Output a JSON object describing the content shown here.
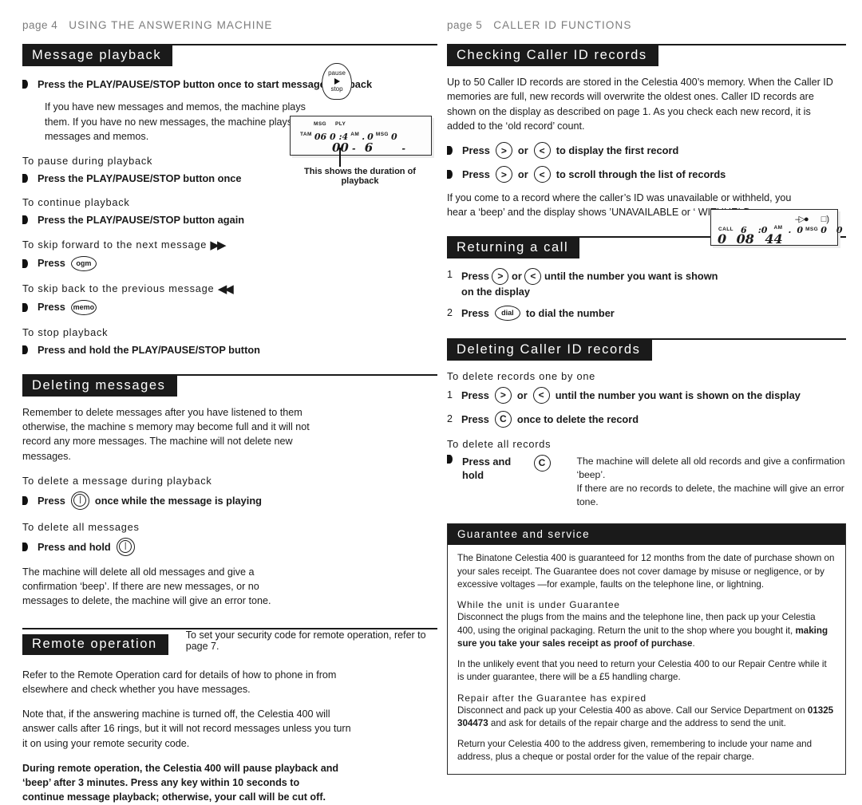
{
  "left": {
    "runhead": {
      "page": "page 4",
      "title": "USING THE ANSWERING MACHINE"
    },
    "s1": {
      "heading": "Message playback",
      "a1": "Press the PLAY/PAUSE/STOP button once to start message playback",
      "a1_note": "If you have new messages and memos, the machine plays them. If you have no new messages, the machine plays all messages and memos.",
      "sub1": "To pause during playback",
      "a2": "Press the PLAY/PAUSE/STOP button once",
      "sub2": "To continue playback",
      "a3": "Press the PLAY/PAUSE/STOP button again",
      "sub3": "To skip forward to the next message",
      "a4": "Press",
      "a4_key": "ogm",
      "sub4": "To skip back to the previous message",
      "a5": "Press",
      "a5_key": "memo",
      "sub5": "To stop playback",
      "a6": "Press and hold the PLAY/PAUSE/STOP button",
      "pause_key": {
        "top": "pause",
        "bottom": "stop"
      }
    },
    "lcd1": {
      "label_msg": "MSG",
      "label_ply": "PLY",
      "tam": "TAM",
      "row_a": "06 0 :4",
      "row_a_am": "AM",
      "row_a_dot": ".",
      "row_a_b": "0",
      "row_a_msg": "MSG",
      "row_a_c": "0",
      "row_b": "00",
      "row_b2": "6",
      "row_b_dash": "-",
      "row_b_dash2": "-",
      "caption": "This shows the duration of playback"
    },
    "s2": {
      "heading": "Deleting messages",
      "p1": "Remember to delete messages after you have listened to them   otherwise, the machine s memory may become full and it will not record any more messages. The machine will not delete new messages.",
      "sub1": "To delete a message during playback",
      "a1_pre": "Press",
      "a1_post": "once while the message is playing",
      "sub2": "To delete all messages",
      "a2_pre": "Press and hold",
      "note": "The machine will delete all old messages and give a confirmation ‘beep’. If there are new messages, or no messages to delete, the machine will give an error tone."
    },
    "s3": {
      "heading": "Remote operation",
      "note": "To set your security code for remote operation, refer to page 7.",
      "p1": "Refer to the Remote Operation card for details of how to phone in from elsewhere and check whether you have messages.",
      "p2": "Note that, if the answering machine is turned off, the Celestia 400 will answer calls after 16 rings, but it will not record messages unless you turn it on using your remote security code.",
      "p3": "During remote operation, the Celestia 400 will pause playback and ‘beep’ after 3 minutes. Press any key within 10 seconds to continue message playback; otherwise, your call will be cut off."
    }
  },
  "right": {
    "runhead": {
      "page": "page 5",
      "title": "CALLER ID FUNCTIONS"
    },
    "s1": {
      "heading": "Checking Caller ID records",
      "p1": "Up to 50 Caller ID records are stored in the Celestia 400’s memory.  When the Caller ID memories are full, new records will overwrite the oldest ones. Caller ID records are shown on the display as described on page 1. As you check each new record, it is added to the ‘old record’ count.",
      "a1_pre": "Press",
      "a1_or": "or",
      "a1_post": "to display the first record",
      "a2_pre": "Press",
      "a2_or": "or",
      "a2_post": "to scroll through the list of records",
      "p2": "If you come to a record where the caller’s ID was unavailable or withheld, you hear a ‘beep’ and the display shows ’UNAVAILABLE or ‘ WITHHELD"
    },
    "s2": {
      "heading": "Returning a call",
      "n1": "1",
      "n1_pre": "Press",
      "n1_or": "or",
      "n1_post": "until the number you want is shown",
      "n1_post2": "on the display",
      "n2": "2",
      "n2_pre": "Press",
      "n2_key": "dial",
      "n2_post": "to dial the number"
    },
    "lcd2": {
      "call": "CALL",
      "row_a1": "6",
      "row_a2": ":0",
      "row_a_am": "AM",
      "row_a_dot": ".",
      "row_a3": "0",
      "row_a_msg": "MSG",
      "row_a4": "0",
      "row_a5": "0",
      "row_b1": "0",
      "row_b2": "08",
      "row_b3": "44"
    },
    "s3": {
      "heading": "Deleting Caller ID records",
      "sub1": "To delete records one by one",
      "n1": "1",
      "n1_pre": "Press",
      "n1_or": "or",
      "n1_post": "until the number you want is shown on the display",
      "n2": "2",
      "n2_pre": "Press",
      "n2_key": "C",
      "n2_post": "once to delete the record",
      "sub2": "To delete all records",
      "a1_pre": "Press and hold",
      "a1_key": "C",
      "note1": "The machine will delete all old records and give a confirmation ‘beep’.",
      "note2": "If there are no records to delete, the machine will give an error tone."
    },
    "gbox": {
      "heading": "Guarantee and service",
      "p1": "The Binatone Celestia 400 is guaranteed for 12 months from the date of purchase shown on your sales receipt. The Guarantee does not cover damage by misuse or negligence, or by excessive voltages —for example, faults on the telephone line, or lightning.",
      "sub1": "While the unit is under Guarantee",
      "p2_a": "Disconnect the plugs from the mains and the telephone line, then pack up your Celestia 400, using the original packaging. Return the unit to the shop where you bought it, ",
      "p2_b": "making sure you take your sales receipt as proof of purchase",
      "p2_c": ".",
      "p3": "In the unlikely event that you need to return your Celestia 400 to our Repair Centre while it is under guarantee, there will be a £5 handling charge.",
      "sub2": "Repair after the Guarantee has expired",
      "p4_a": "Disconnect and pack up your Celestia 400 as above. Call our Service Department on ",
      "p4_b": "01325 304473",
      "p4_c": " and ask for details of the repair charge and the address to send the unit.",
      "p5": "Return your Celestia 400 to the address given, remembering to include your name and address, plus a cheque or postal order for the value of the repair charge."
    }
  },
  "icons": {
    "arrow_right": "›",
    "arrow_left": "‹",
    "fast_forward": "▶▶",
    "rewind": "◀◀",
    "delete_glyph": "⏻",
    "speaker": "◁)",
    "callarrow": "▷"
  }
}
